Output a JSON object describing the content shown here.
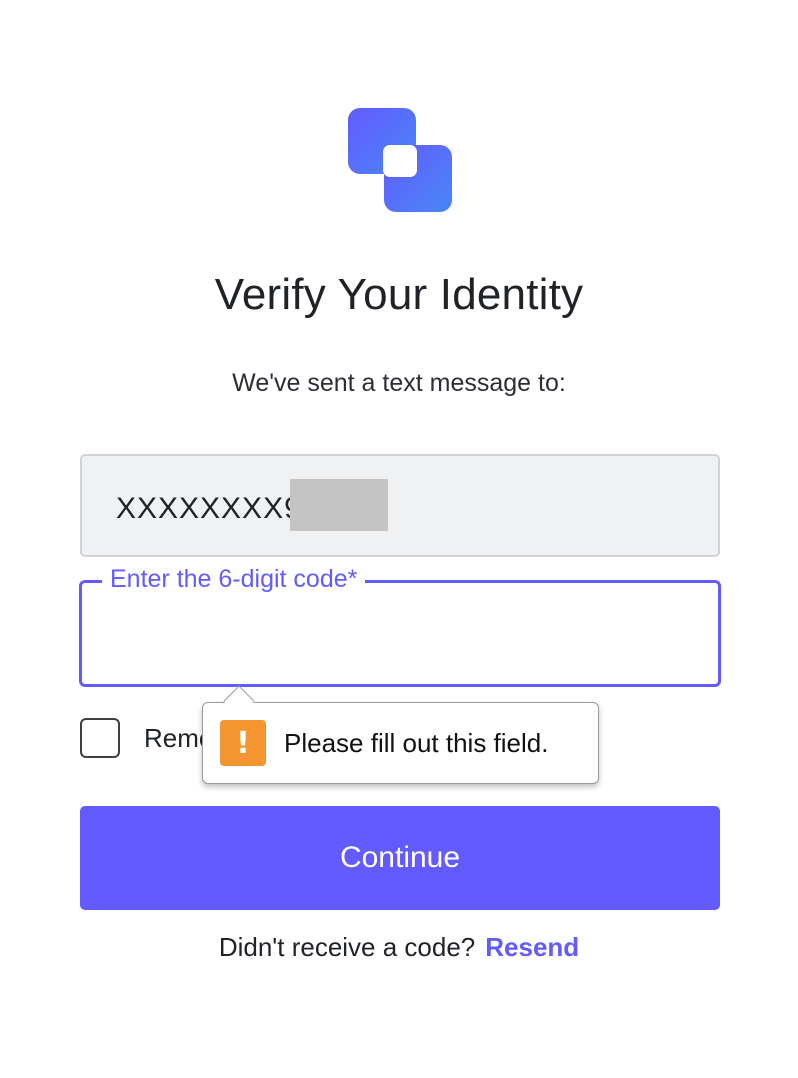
{
  "logo": {
    "icon": "brand-logo-icon",
    "colors": [
      "#635bff",
      "#4a86f7"
    ]
  },
  "heading": {
    "title": "Verify Your Identity",
    "subtitle": "We've sent a text message to:"
  },
  "phone": {
    "value": "XXXXXXXX9"
  },
  "code_field": {
    "label": "Enter the 6-digit code*",
    "value": ""
  },
  "remember": {
    "label": "Remember this device",
    "checked": false
  },
  "tooltip": {
    "icon": "warning-icon",
    "text": "Please fill out this field."
  },
  "continue_button": {
    "label": "Continue"
  },
  "resend": {
    "prompt": "Didn't receive a code?",
    "link_label": "Resend"
  },
  "colors": {
    "accent": "#635bff",
    "warning": "#f5952f"
  }
}
